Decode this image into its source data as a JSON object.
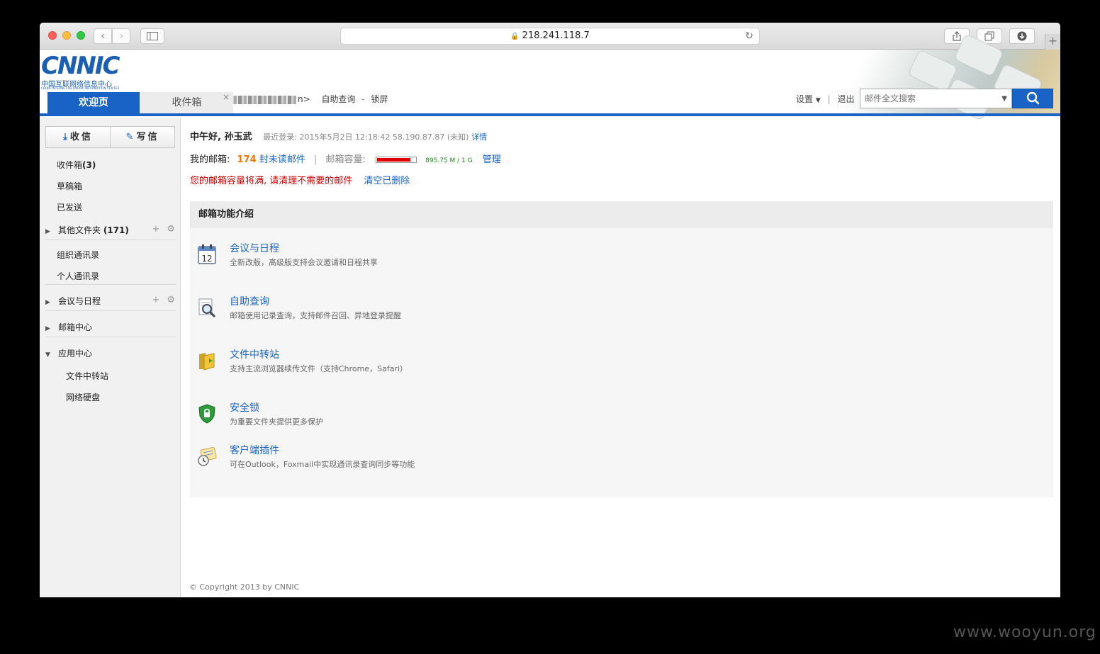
{
  "browser": {
    "url": "218.241.118.7"
  },
  "header": {
    "logo_text": "CNNIC",
    "logo_cn": "中国互联网络信息中心",
    "logo_en": "CHINA INTERNET NETWORK INFORMATION CENTER",
    "user_suffix": "n>",
    "self_query": "自助查询",
    "separator": "-",
    "lock_screen": "锁屏",
    "settings": "设置",
    "settings_arrow": "▼",
    "pipe": "|",
    "logout": "退出",
    "search_placeholder": "邮件全文搜索"
  },
  "tabs": [
    {
      "label": "欢迎页"
    },
    {
      "label": "收件箱"
    }
  ],
  "sidebar": {
    "receive": "收信",
    "compose": "写信",
    "inbox": "收件箱",
    "inbox_count": "(3)",
    "drafts": "草稿箱",
    "sent": "已发送",
    "other_folders": "其他文件夹",
    "other_count": "(171)",
    "org_contacts": "组织通讯录",
    "personal_contacts": "个人通讯录",
    "meetings": "会议与日程",
    "mail_center": "邮箱中心",
    "app_center": "应用中心",
    "file_transfer": "文件中转站",
    "net_disk": "网络硬盘",
    "add_symbol": "+",
    "gear_symbol": "⚙"
  },
  "main": {
    "greeting": "中午好, 孙玉武",
    "last_login": "最近登录: 2015年5月2日 12:18:42 58.190.87.87 (未知)",
    "details": "详情",
    "my_mailbox": "我的邮箱:",
    "unread_count": "174",
    "unread_label": "封未读邮件",
    "capacity_label": "邮箱容量:",
    "capacity_fraction": 0.874,
    "capacity_text": "895.75 M / 1 G",
    "manage": "管理",
    "warning": "您的邮箱容量将满, 请清理不需要的邮件",
    "clear_deleted": "清空已删除",
    "features_title": "邮箱功能介绍",
    "features": [
      {
        "title": "会议与日程",
        "desc": "全新改版，高级版支持会议邀请和日程共享",
        "icon": "calendar-icon",
        "icon_text": "12"
      },
      {
        "title": "自助查询",
        "desc": "邮箱使用记录查询，支持邮件召回、异地登录提醒",
        "icon": "magnifier-doc-icon"
      },
      {
        "title": "文件中转站",
        "desc": "支持主流浏览器续传文件（支持Chrome，Safari）",
        "icon": "folder-icon"
      },
      {
        "title": "安全锁",
        "desc": "为重要文件夹提供更多保护",
        "icon": "shield-lock-icon"
      },
      {
        "title": "客户端插件",
        "desc": "可在Outlook，Foxmail中实现通讯录查询同步等功能",
        "icon": "plugin-clock-icon"
      }
    ],
    "copyright": "© Copyright 2013 by CNNIC"
  },
  "watermark": "www.wooyun.org",
  "colors": {
    "brand_blue": "#1a63c6",
    "warning_red": "#d40000",
    "unread_orange": "#f07800"
  }
}
